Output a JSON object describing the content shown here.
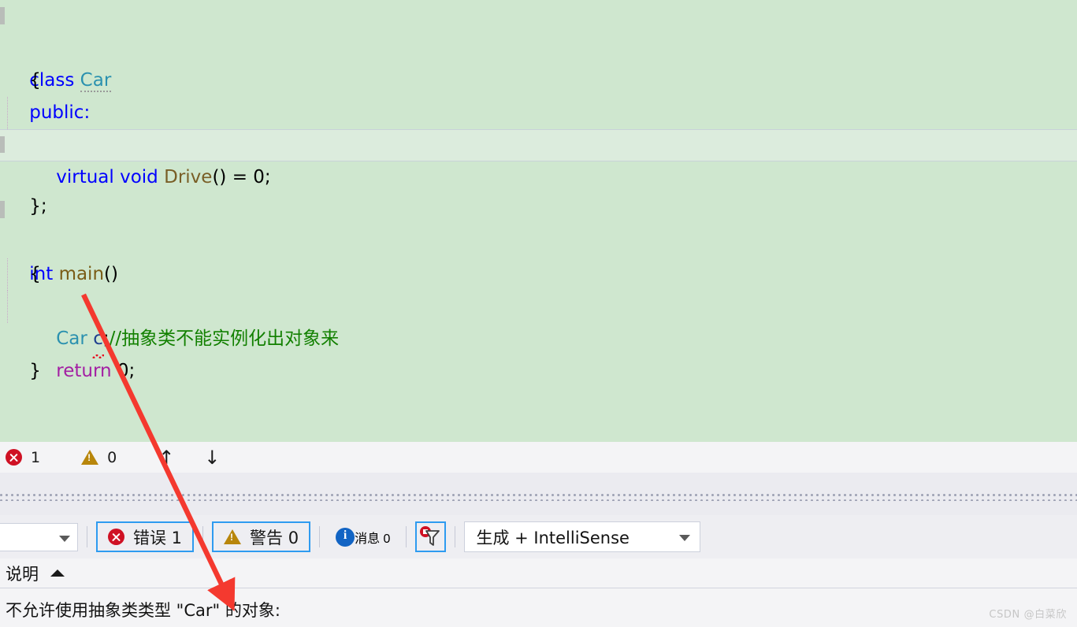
{
  "editor": {
    "background_color": "#cfe7cf",
    "current_line_color": "#dcecdd",
    "lines": [
      {
        "id": "l1",
        "text": "class Car"
      },
      {
        "id": "l2",
        "text": "{"
      },
      {
        "id": "l3",
        "text": "public:"
      },
      {
        "id": "l4",
        "text": "    virtual void Drive() = 0;"
      },
      {
        "id": "l5",
        "text": "};"
      },
      {
        "id": "l6",
        "text": ""
      },
      {
        "id": "l7",
        "text": "int main()"
      },
      {
        "id": "l8",
        "text": "{"
      },
      {
        "id": "l9",
        "text": "    Car c;//抽象类不能实例化出对象来"
      },
      {
        "id": "l10",
        "text": "    return 0;"
      },
      {
        "id": "l11",
        "text": "}"
      }
    ],
    "tokens": {
      "kw_class": "class",
      "type_car": "Car",
      "brace_open": "{",
      "kw_public": "public:",
      "kw_virtual": "virtual",
      "kw_void": "void",
      "fn_drive": "Drive",
      "drive_tail": "() = 0;",
      "brace_close_semi": "};",
      "kw_int": "int",
      "fn_main": "main",
      "main_tail": "()",
      "type_car2": "Car",
      "var_c": "c",
      "semi": ";",
      "comment": "//抽象类不能实例化出对象来",
      "kw_return": "return",
      "return_tail": " 0;",
      "brace_close": "}"
    },
    "colors": {
      "keyword": "#0000ff",
      "user_type": "#2b91af",
      "function": "#795e26",
      "control": "#a31fa3",
      "comment": "#128000",
      "variable": "#1f3f8f",
      "plain": "#000000",
      "squiggle": "#e81123"
    }
  },
  "editor_status": {
    "error_count": "1",
    "warning_count": "0",
    "prev_arrow": "↑",
    "next_arrow": "↓"
  },
  "error_list": {
    "search_value": "",
    "errors_label": "错误 1",
    "warnings_label": "警告 0",
    "messages_label": "消息 0",
    "build_filter_value": "生成 + IntelliSense",
    "accent_selected": "#2e9bf0",
    "error_red": "#cf1124",
    "warning_gold": "#b8860b",
    "info_blue": "#1264c4"
  },
  "description": {
    "header": "说明",
    "message": "不允许使用抽象类类型 \"Car\" 的对象:"
  },
  "watermark": {
    "text": "CSDN @白菜欣"
  },
  "annotation": {
    "arrow_color": "#f4392f",
    "description": "红色箭头"
  }
}
